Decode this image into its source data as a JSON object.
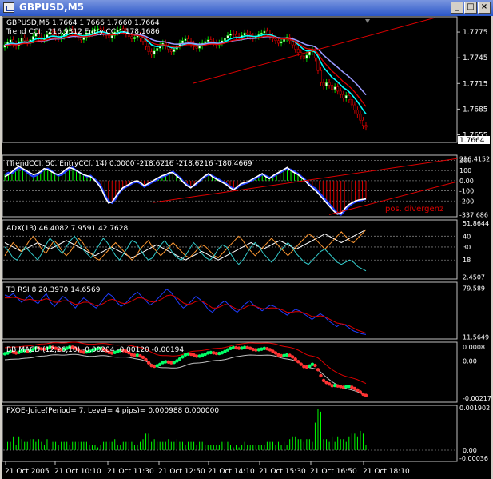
{
  "window": {
    "title": "GBPUSD,M5",
    "minimize_label": "_",
    "maximize_label": "□",
    "close_label": "×"
  },
  "colors": {
    "background": "#000000",
    "border": "#c0c0c0",
    "bull_candle": "#00cc00",
    "bear_candle": "#cc0000",
    "ema_fast": "#00ffff",
    "ema_slow": "#9999ff",
    "trend_red": "#dd0000",
    "white_line": "#ffffff",
    "blue_line": "#1f3dff",
    "adx_orange": "#ff9933",
    "adx_cyan": "#33cccc",
    "green_hist": "#00ff00",
    "macd_dot_red": "#ff3333",
    "macd_dot_green": "#00ff66"
  },
  "panels": [
    {
      "id": "price",
      "labels": [
        "GBPUSD,M5  1.7664 1.7666 1.7660 1.7664",
        "Trend CCI: -216.9312 Entry CCI: -178.1686"
      ],
      "axis": [
        "1.7775",
        "1.7745",
        "1.7715",
        "1.7685",
        "1.7655"
      ],
      "current_price": "1.7664"
    },
    {
      "id": "cci",
      "labels": [
        "(TrendCCI, 50, EntryCCI, 14)  0.0000 -218.6216 -218.6216 -180.4669"
      ],
      "axis": [
        "216.4152",
        "200",
        "100",
        "0.00",
        "-100",
        "-200",
        "-337.686"
      ],
      "annotation": "pos. divergenz"
    },
    {
      "id": "adx",
      "labels": [
        "ADX(13) 46.4082 7.9591 42.7628"
      ],
      "axis": [
        "51.8644",
        "40",
        "30",
        "18",
        "2.4507"
      ]
    },
    {
      "id": "rsi",
      "labels": [
        "T3 RSI 8 20.3970 14.6569"
      ],
      "axis": [
        "79.589",
        "11.5649"
      ]
    },
    {
      "id": "macd",
      "labels": [
        "BB MACD (12,26,10) -0.00204 -0.00120 -0.00194"
      ],
      "axis": [
        "0.0008",
        "0.00",
        "-0.00217"
      ]
    },
    {
      "id": "fxoe",
      "labels": [
        "FXOE-Juice(Period= 7, Level= 4 pips)=  0.000988 0.000000"
      ],
      "axis": [
        "0.001902",
        "0.00",
        "-0.00036"
      ]
    }
  ],
  "time_axis": [
    "21 Oct 2005",
    "21 Oct 10:10",
    "21 Oct 11:30",
    "21 Oct 12:50",
    "21 Oct 14:10",
    "21 Oct 15:30",
    "21 Oct 16:50",
    "21 Oct 18:10"
  ],
  "series": {
    "close": [
      1.776,
      1.7763,
      1.7766,
      1.7761,
      1.7759,
      1.7764,
      1.7768,
      1.7765,
      1.7762,
      1.7766,
      1.777,
      1.7773,
      1.7769,
      1.7766,
      1.7768,
      1.7772,
      1.7775,
      1.7772,
      1.7769,
      1.7767,
      1.777,
      1.7773,
      1.7776,
      1.7778,
      1.7775,
      1.7772,
      1.7769,
      1.7766,
      1.7769,
      1.7772,
      1.7774,
      1.7776,
      1.7778,
      1.7779,
      1.7777,
      1.7774,
      1.7771,
      1.7768,
      1.7771,
      1.7775,
      1.7777,
      1.7779,
      1.7776,
      1.7773,
      1.777,
      1.7767,
      1.7769,
      1.7771,
      1.7768,
      1.7764,
      1.7758,
      1.7752,
      1.7749,
      1.7753,
      1.7756,
      1.7759,
      1.7762,
      1.7759,
      1.7755,
      1.7752,
      1.7755,
      1.7759,
      1.7762,
      1.7765,
      1.7767,
      1.7764,
      1.7761,
      1.7758,
      1.7756,
      1.7759,
      1.7762,
      1.7764,
      1.7766,
      1.7764,
      1.7762,
      1.776,
      1.7762,
      1.7765,
      1.7768,
      1.7771,
      1.7773,
      1.7772,
      1.777,
      1.7769,
      1.7771,
      1.7774,
      1.7772,
      1.777,
      1.7768,
      1.777,
      1.7772,
      1.7774,
      1.7776,
      1.7773,
      1.777,
      1.7767,
      1.7765,
      1.7762,
      1.7764,
      1.7767,
      1.7769,
      1.7765,
      1.776,
      1.7755,
      1.7751,
      1.7747,
      1.7744,
      1.7748,
      1.7752,
      1.7755,
      1.7745,
      1.773,
      1.7716,
      1.7712,
      1.7716,
      1.7713,
      1.7708,
      1.7711,
      1.7706,
      1.7702,
      1.7698,
      1.7701,
      1.7696,
      1.769,
      1.7684,
      1.7679,
      1.7672,
      1.7666,
      1.7664
    ],
    "cci": [
      60,
      80,
      70,
      100,
      130,
      110,
      90,
      60,
      40,
      55,
      80,
      110,
      120,
      100,
      70,
      50,
      60,
      90,
      120,
      130,
      100,
      80,
      60,
      40,
      50,
      20,
      -10,
      -60,
      -140,
      -200,
      -220,
      -180,
      -120,
      -80,
      -60,
      -40,
      -20,
      -10,
      -30,
      -60,
      -40,
      -20,
      0,
      20,
      40,
      50,
      70,
      90,
      60,
      30,
      -10,
      -40,
      -60,
      -50,
      -20,
      10,
      40,
      60,
      50,
      30,
      10,
      -10,
      -30,
      -60,
      -80,
      -70,
      -40,
      -30,
      -20,
      0,
      20,
      40,
      60,
      50,
      30,
      40,
      60,
      80,
      100,
      120,
      110,
      90,
      70,
      40,
      10,
      -30,
      -60,
      -80,
      -120,
      -160,
      -200,
      -240,
      -280,
      -320,
      -337,
      -300,
      -260,
      -230,
      -210,
      -200,
      -190,
      -180
    ],
    "entry_cci": [
      40,
      60,
      90,
      120,
      140,
      120,
      100,
      80,
      60,
      70,
      90,
      120,
      110,
      90,
      70,
      60,
      80,
      110,
      130,
      120,
      100,
      80,
      60,
      50,
      40,
      10,
      -30,
      -80,
      -160,
      -220,
      -210,
      -160,
      -110,
      -70,
      -50,
      -30,
      -10,
      0,
      -20,
      -50,
      -30,
      -10,
      10,
      30,
      50,
      60,
      80,
      80,
      50,
      20,
      -20,
      -50,
      -70,
      -40,
      -10,
      20,
      50,
      70,
      40,
      20,
      0,
      -20,
      -40,
      -70,
      -90,
      -60,
      -30,
      -20,
      -10,
      10,
      30,
      50,
      70,
      40,
      20,
      50,
      70,
      90,
      110,
      130,
      100,
      80,
      60,
      30,
      0,
      -40,
      -70,
      -100,
      -140,
      -180,
      -220,
      -260,
      -300,
      -330,
      -320,
      -280,
      -240,
      -220,
      -200,
      -190,
      -185,
      -180
    ],
    "adx_plus": [
      22,
      28,
      34,
      30,
      26,
      30,
      36,
      40,
      34,
      28,
      24,
      30,
      36,
      32,
      26,
      22,
      26,
      32,
      38,
      34,
      28,
      24,
      20,
      18,
      22,
      26,
      30,
      34,
      30,
      26,
      22,
      18,
      22,
      28,
      32,
      36,
      30,
      26,
      22,
      26,
      30,
      34,
      30,
      26,
      22,
      20,
      24,
      28,
      32,
      30,
      26,
      22,
      20,
      24,
      28,
      32,
      36,
      40,
      36,
      30,
      26,
      22,
      26,
      30,
      34,
      38,
      34,
      30,
      26,
      22,
      26,
      30,
      34,
      38,
      42,
      40,
      36,
      32,
      28,
      32,
      36,
      40,
      44,
      40,
      36,
      34,
      38,
      42,
      46
    ],
    "adx_minus": [
      30,
      26,
      20,
      18,
      24,
      30,
      26,
      22,
      18,
      24,
      32,
      38,
      34,
      28,
      24,
      30,
      36,
      40,
      34,
      28,
      24,
      20,
      26,
      32,
      38,
      34,
      28,
      22,
      18,
      24,
      30,
      36,
      34,
      28,
      22,
      18,
      20,
      26,
      32,
      36,
      30,
      24,
      20,
      18,
      22,
      28,
      34,
      30,
      24,
      20,
      18,
      22,
      28,
      32,
      30,
      24,
      18,
      14,
      18,
      24,
      30,
      34,
      30,
      24,
      20,
      16,
      20,
      26,
      30,
      34,
      30,
      24,
      20,
      16,
      14,
      18,
      22,
      26,
      28,
      24,
      20,
      16,
      14,
      16,
      18,
      16,
      12,
      10,
      8
    ],
    "adx_main": [
      34,
      32,
      30,
      28,
      26,
      28,
      30,
      32,
      34,
      32,
      30,
      28,
      30,
      32,
      34,
      36,
      34,
      32,
      30,
      28,
      26,
      24,
      22,
      24,
      26,
      28,
      30,
      28,
      26,
      24,
      22,
      20,
      22,
      24,
      26,
      28,
      30,
      32,
      30,
      28,
      26,
      24,
      22,
      20,
      18,
      20,
      22,
      24,
      26,
      24,
      22,
      20,
      18,
      20,
      22,
      24,
      26,
      28,
      30,
      32,
      34,
      32,
      30,
      28,
      30,
      32,
      34,
      36,
      34,
      32,
      30,
      28,
      30,
      32,
      34,
      36,
      38,
      40,
      42,
      40,
      38,
      36,
      34,
      36,
      38,
      40,
      42,
      44,
      46
    ],
    "rsi_a": [
      70,
      68,
      72,
      66,
      60,
      64,
      70,
      62,
      58,
      66,
      72,
      60,
      54,
      62,
      68,
      64,
      58,
      52,
      60,
      66,
      62,
      56,
      52,
      58,
      66,
      72,
      68,
      60,
      54,
      58,
      64,
      70,
      74,
      68,
      62,
      56,
      60,
      66,
      72,
      78,
      74,
      66,
      58,
      52,
      56,
      62,
      68,
      64,
      58,
      50,
      46,
      52,
      58,
      62,
      56,
      50,
      46,
      52,
      58,
      62,
      56,
      52,
      48,
      52,
      56,
      54,
      50,
      46,
      42,
      46,
      50,
      48,
      44,
      40,
      36,
      40,
      44,
      40,
      34,
      30,
      26,
      30,
      28,
      24,
      20,
      18,
      16,
      15
    ],
    "rsi_b": [
      66,
      66,
      67,
      66,
      64,
      63,
      64,
      63,
      62,
      63,
      65,
      63,
      60,
      60,
      62,
      62,
      60,
      57,
      58,
      60,
      60,
      58,
      55,
      56,
      59,
      63,
      64,
      62,
      59,
      58,
      60,
      63,
      66,
      66,
      64,
      61,
      60,
      62,
      65,
      69,
      70,
      68,
      64,
      59,
      57,
      58,
      61,
      62,
      60,
      56,
      52,
      52,
      54,
      57,
      56,
      53,
      50,
      50,
      53,
      56,
      55,
      53,
      51,
      51,
      52,
      52,
      51,
      49,
      46,
      46,
      47,
      47,
      45,
      43,
      40,
      40,
      41,
      40,
      37,
      34,
      31,
      30,
      29,
      27,
      24,
      21,
      19,
      17
    ]
  }
}
